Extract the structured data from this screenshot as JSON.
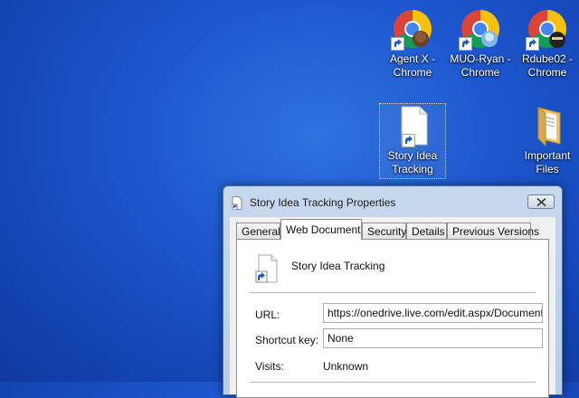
{
  "desktop": {
    "icons": [
      {
        "label_line1": "Agent X -",
        "label_line2": "Chrome",
        "icon": "chrome-icon"
      },
      {
        "label_line1": "MUO-Ryan -",
        "label_line2": "Chrome",
        "icon": "chrome-icon"
      },
      {
        "label_line1": "Rdube02 -",
        "label_line2": "Chrome",
        "icon": "chrome-icon"
      },
      {
        "label_line1": "Story Idea",
        "label_line2": "Tracking",
        "icon": "document-shortcut-icon"
      },
      {
        "label_line1": "Important",
        "label_line2": "Files",
        "icon": "folder-icon"
      }
    ]
  },
  "dialog": {
    "title": "Story Idea Tracking Properties",
    "tabs": [
      "General",
      "Web Document",
      "Security",
      "Details",
      "Previous Versions"
    ],
    "active_tab": "Web Document",
    "file_name": "Story Idea Tracking",
    "url_label": "URL:",
    "url_value": "https://onedrive.live.com/edit.aspx/Documents",
    "shortcut_label": "Shortcut key:",
    "shortcut_value": "None",
    "visits_label": "Visits:",
    "visits_value": "Unknown"
  },
  "colors": {
    "desktop_blue": "#1d57cf",
    "dialog_frame": "#c7d8ee"
  }
}
